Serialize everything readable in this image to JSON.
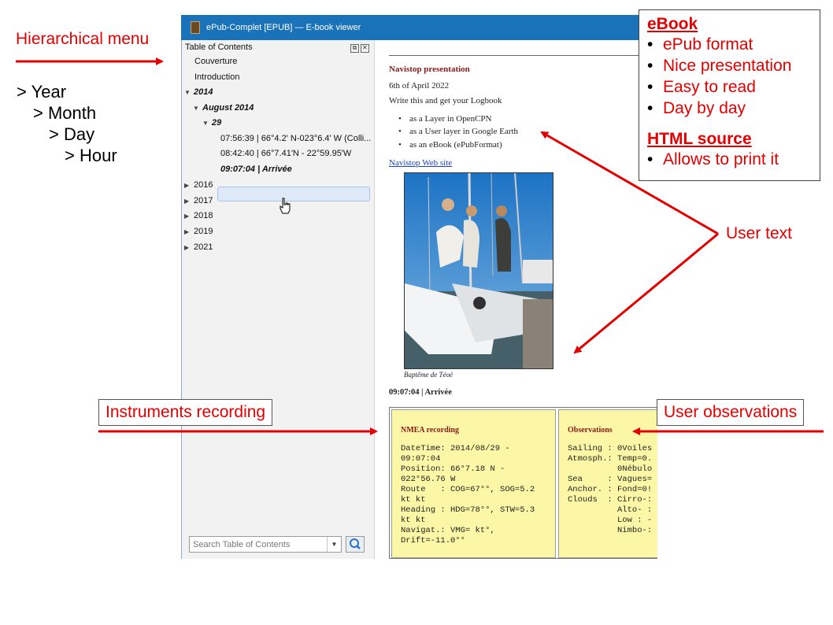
{
  "annotations": {
    "hierarchical_menu": "Hierarchical menu",
    "tree": [
      "> Year",
      "> Month",
      "> Day",
      "> Hour"
    ],
    "user_text": "User text",
    "instruments_recording": "Instruments recording",
    "user_observations": "User observations",
    "ebook_box": {
      "ebook_title": "eBook",
      "ebook_items": [
        "ePub format",
        "Nice presentation",
        "Easy to read",
        "Day by day"
      ],
      "html_title": "HTML source",
      "html_items": [
        "Allows to print it"
      ]
    },
    "colors": {
      "annotation_red": "#e30000"
    }
  },
  "window": {
    "title": "ePub-Complet [EPUB] — E-book viewer",
    "titlebar_color": "#1a73b8"
  },
  "toc": {
    "header": "Table of Contents",
    "items": [
      {
        "label": "Couverture"
      },
      {
        "label": "Introduction"
      },
      {
        "label": "2014",
        "state": "expanded"
      },
      {
        "label": "August 2014",
        "state": "expanded"
      },
      {
        "label": "29",
        "state": "expanded"
      },
      {
        "label": "07:56:39 | 66°4.2' N-023°6.4' W (Colli..."
      },
      {
        "label": "08:42:40 | 66°7.41'N - 22°59.95'W"
      },
      {
        "label": "09:07:04 | Arrivée",
        "state": "selected"
      },
      {
        "label": "2016",
        "state": "collapsed"
      },
      {
        "label": "2017",
        "state": "collapsed"
      },
      {
        "label": "2018",
        "state": "collapsed"
      },
      {
        "label": "2019",
        "state": "collapsed"
      },
      {
        "label": "2021",
        "state": "collapsed"
      }
    ],
    "search_placeholder": "Search Table of Contents"
  },
  "book": {
    "heading": "Navistop presentation",
    "date": "6th of April 2022",
    "intro": "Write this and get your Logbook",
    "bullets": [
      "as a Layer in OpenCPN",
      "as a User layer in Google Earth",
      "as an eBook (ePubFormat)"
    ],
    "link": "Navistop Web site",
    "caption": "Baptême de Téoé",
    "entry": "09:07:04 | Arrivée",
    "nmea": {
      "title": "NMEA recording",
      "lines": [
        "DateTime: 2014/08/29 -",
        "09:07:04",
        "Position: 66°7.18 N -",
        "022°56.76 W",
        "Route   : COG=67°°, SOG=5.2",
        "kt kt",
        "Heading : HDG=78°°, STW=5.3",
        "kt kt",
        "Navigat.: VMG= kt°,",
        "Drift=-11.0°°"
      ]
    },
    "observations": {
      "title": "Observations",
      "lines": [
        "Sailing : 0Voiles",
        "Atmosph.: Temp=0.",
        "          0Nébulo",
        "Sea     : Vagues=",
        "Anchor. : Fond=0!",
        "Clouds  : Cirro-:",
        "          Alto- :",
        "          Low : -",
        "          Nimbo-:"
      ]
    },
    "cell_color": "#fbf7a6"
  }
}
